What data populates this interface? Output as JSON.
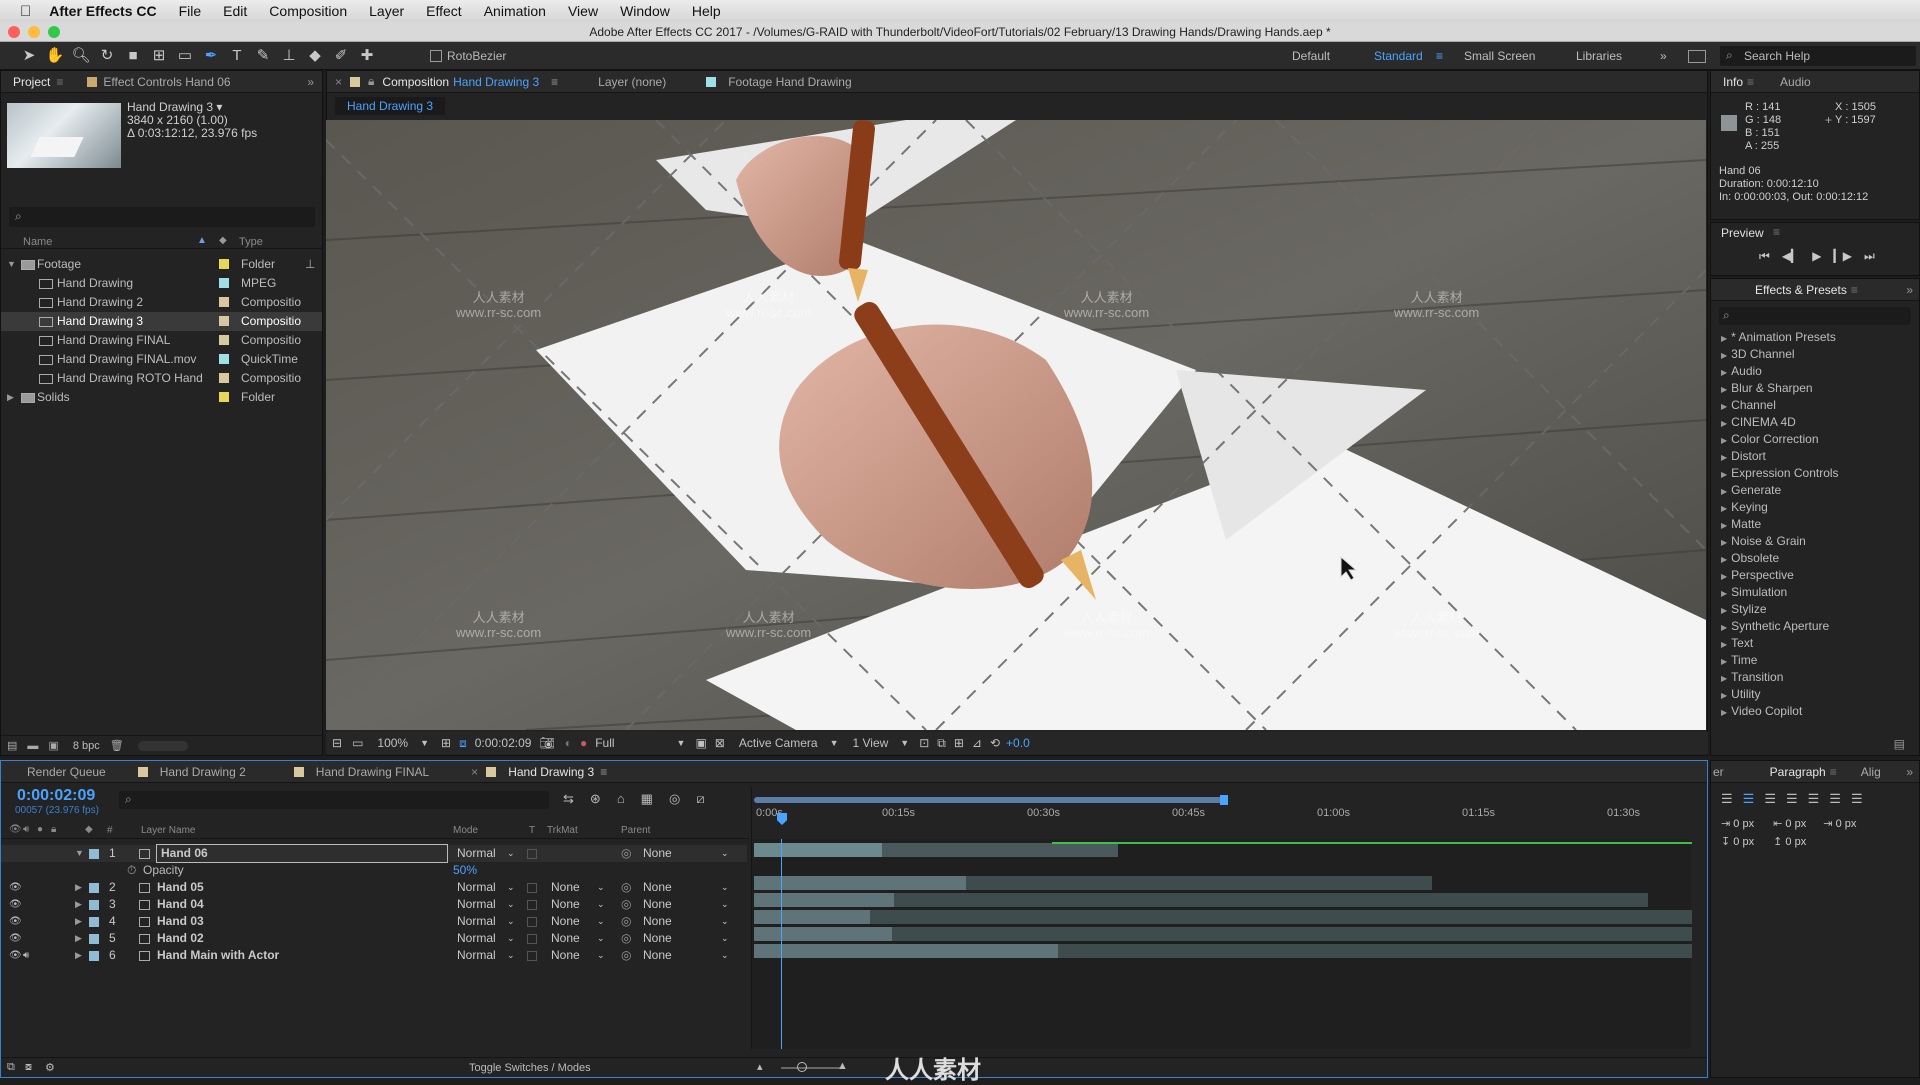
{
  "menubar": {
    "apple": "",
    "app": "After Effects CC",
    "items": [
      "File",
      "Edit",
      "Composition",
      "Layer",
      "Effect",
      "Animation",
      "View",
      "Window",
      "Help"
    ]
  },
  "titlebar": {
    "title": "Adobe After Effects CC 2017 - /Volumes/G-RAID with Thunderbolt/VideoFort/Tutorials/02 February/13 Drawing Hands/Drawing Hands.aep *"
  },
  "watermark": {
    "cn": "人人素材",
    "url": "www.rr-sc.com",
    "logo": "人人素材"
  },
  "toolbar": {
    "rotobezier": "RotoBezier",
    "workspaces": [
      "Default",
      "Standard",
      "Small Screen",
      "Libraries"
    ],
    "active_ws": "Standard",
    "search": "Search Help"
  },
  "project": {
    "tab1": "Project",
    "tab2": "Effect Controls Hand 06",
    "thumb_name": "Hand Drawing 3 ▾",
    "thumb_res": "3840 x 2160 (1.00)",
    "thumb_dur": "Δ 0:03:12:12, 23.976 fps",
    "col_name": "Name",
    "col_type": "Type",
    "items": [
      {
        "name": "Footage",
        "type": "Folder",
        "indent": 0,
        "color": "#e8d65b",
        "icon": "folder-icon",
        "sel": false,
        "arrow": "▼"
      },
      {
        "name": "Hand Drawing",
        "type": "MPEG",
        "indent": 1,
        "color": "#9fe0e8",
        "icon": "footage-icon",
        "sel": false,
        "arrow": ""
      },
      {
        "name": "Hand Drawing 2",
        "type": "Compositio",
        "indent": 1,
        "color": "#d8c8a0",
        "icon": "composition-icon",
        "sel": false,
        "arrow": ""
      },
      {
        "name": "Hand Drawing 3",
        "type": "Compositio",
        "indent": 1,
        "color": "#d8c8a0",
        "icon": "composition-icon",
        "sel": true,
        "arrow": ""
      },
      {
        "name": "Hand Drawing FINAL",
        "type": "Compositio",
        "indent": 1,
        "color": "#d8c8a0",
        "icon": "composition-icon",
        "sel": false,
        "arrow": ""
      },
      {
        "name": "Hand Drawing FINAL.mov",
        "type": "QuickTime",
        "indent": 1,
        "color": "#9fe0e8",
        "icon": "footage-icon",
        "sel": false,
        "arrow": ""
      },
      {
        "name": "Hand Drawing ROTO Hand",
        "type": "Compositio",
        "indent": 1,
        "color": "#d8c8a0",
        "icon": "composition-icon",
        "sel": false,
        "arrow": ""
      },
      {
        "name": "Solids",
        "type": "Folder",
        "indent": 0,
        "color": "#e8d65b",
        "icon": "folder-icon",
        "sel": false,
        "arrow": "▶"
      }
    ],
    "bpc": "8 bpc"
  },
  "comp": {
    "tab_prefix": "Composition",
    "tab_name": "Hand Drawing 3",
    "layer_tab": "Layer (none)",
    "footage_tab": "Footage Hand Drawing",
    "breadcrumb": "Hand Drawing 3",
    "zoom": "100%",
    "time": "0:00:02:09",
    "resolution": "Full",
    "camera": "Active Camera",
    "views": "1 View",
    "exposure": "+0.0"
  },
  "info": {
    "tab": "Info",
    "tab2": "Audio",
    "r": "R : 141",
    "g": "G : 148",
    "b": "B : 151",
    "a": "A : 255",
    "x": "X : 1505",
    "y": "Y : 1597",
    "layer": "Hand 06",
    "duration": "Duration: 0:00:12:10",
    "inout": "In: 0:00:00:03, Out: 0:00:12:12",
    "swatch": "#8d9497"
  },
  "preview": {
    "title": "Preview"
  },
  "effects": {
    "title": "Effects & Presets",
    "items": [
      "* Animation Presets",
      "3D Channel",
      "Audio",
      "Blur & Sharpen",
      "Channel",
      "CINEMA 4D",
      "Color Correction",
      "Distort",
      "Expression Controls",
      "Generate",
      "Keying",
      "Matte",
      "Noise & Grain",
      "Obsolete",
      "Perspective",
      "Simulation",
      "Stylize",
      "Synthetic Aperture",
      "Text",
      "Time",
      "Transition",
      "Utility",
      "Video Copilot"
    ]
  },
  "timeline": {
    "tabs": [
      "Render Queue",
      "Hand Drawing 2",
      "Hand Drawing FINAL",
      "Hand Drawing 3"
    ],
    "timecode": "0:00:02:09",
    "frames": "00057 (23.976 fps)",
    "cols": {
      "name": "Layer Name",
      "mode": "Mode",
      "t": "T",
      "trkmat": "TrkMat",
      "parent": "Parent",
      "num": "#"
    },
    "ruler": [
      "0:00s",
      "00:15s",
      "00:30s",
      "00:45s",
      "01:00s",
      "01:15s",
      "01:30s"
    ],
    "layers": [
      {
        "num": "1",
        "name": "Hand 06",
        "mode": "Normal",
        "trkmat": "",
        "parent": "None",
        "open": true,
        "color": "#8fbcd4"
      },
      {
        "num": "2",
        "name": "Hand 05",
        "mode": "Normal",
        "trkmat": "None",
        "parent": "None",
        "open": false,
        "color": "#8fbcd4"
      },
      {
        "num": "3",
        "name": "Hand 04",
        "mode": "Normal",
        "trkmat": "None",
        "parent": "None",
        "open": false,
        "color": "#8fbcd4"
      },
      {
        "num": "4",
        "name": "Hand 03",
        "mode": "Normal",
        "trkmat": "None",
        "parent": "None",
        "open": false,
        "color": "#8fbcd4"
      },
      {
        "num": "5",
        "name": "Hand 02",
        "mode": "Normal",
        "trkmat": "None",
        "parent": "None",
        "open": false,
        "color": "#8fbcd4"
      },
      {
        "num": "6",
        "name": "Hand Main with Actor",
        "mode": "Normal",
        "trkmat": "None",
        "parent": "None",
        "open": false,
        "color": "#8fbcd4"
      }
    ],
    "opacity_label": "Opacity",
    "opacity_value": "50%",
    "toggle": "Toggle Switches / Modes"
  },
  "paragraph": {
    "tab0": "er",
    "tab": "Paragraph",
    "tab2": "Alig",
    "px": "0 px"
  }
}
